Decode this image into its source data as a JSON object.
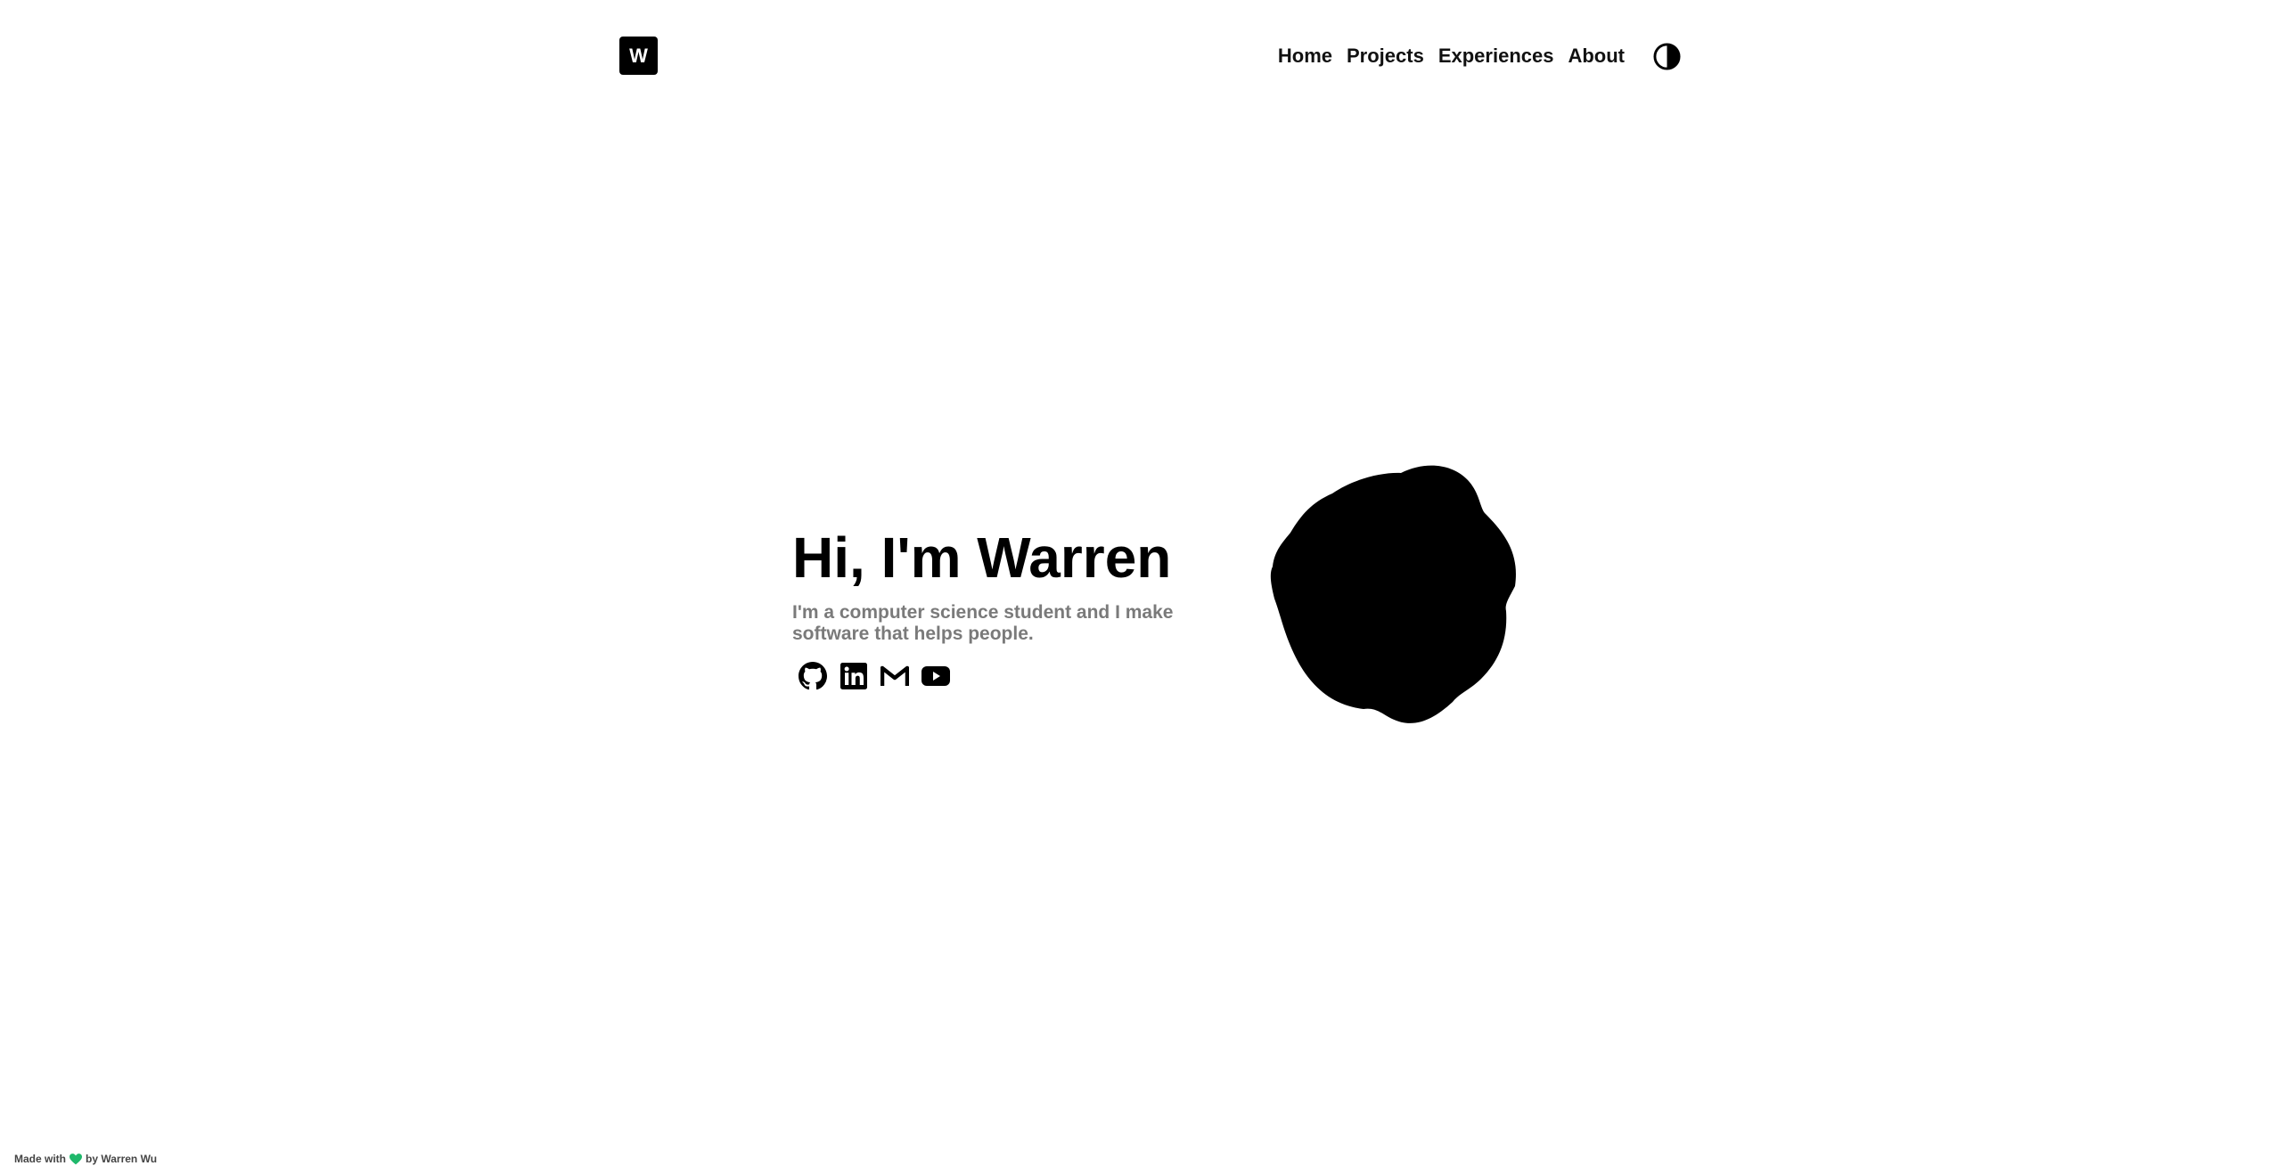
{
  "header": {
    "logo_letter": "W",
    "nav": [
      {
        "label": "Home"
      },
      {
        "label": "Projects"
      },
      {
        "label": "Experiences"
      },
      {
        "label": "About"
      }
    ],
    "theme_toggle_icon": "contrast-icon"
  },
  "hero": {
    "title": "Hi, I'm Warren",
    "subtitle": "I'm a computer science student and I make software that helps people.",
    "socials": [
      {
        "icon": "github-icon"
      },
      {
        "icon": "linkedin-icon"
      },
      {
        "icon": "gmail-icon"
      },
      {
        "icon": "youtube-icon"
      }
    ],
    "blob_color": "#000000"
  },
  "footer": {
    "prefix": "Made with",
    "suffix": "by Warren Wu",
    "heart_color": "#1fb86b"
  }
}
